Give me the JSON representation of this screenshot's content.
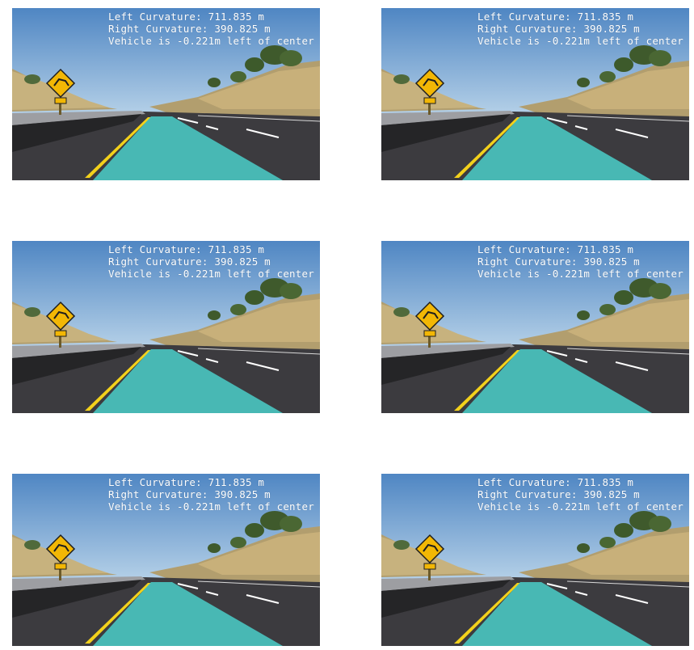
{
  "colors": {
    "sky_top": "#5d8dc4",
    "sky_bottom": "#a9c7e3",
    "lane_fill": "#49c7c1",
    "asphalt": "#3c3b3f",
    "yellow_line": "#f3d11b",
    "hill_dry": "#b29e6e",
    "tree": "#3f5a2c",
    "sign_yellow": "#f2b705"
  },
  "panels": [
    {
      "lines": {
        "left_curvature": "Left Curvature: 711.835 m",
        "right_curvature": "Right Curvature: 390.825 m",
        "vehicle_offset": "Vehicle is -0.221m left of center"
      }
    },
    {
      "lines": {
        "left_curvature": "Left Curvature: 711.835 m",
        "right_curvature": "Right Curvature: 390.825 m",
        "vehicle_offset": "Vehicle is -0.221m left of center"
      }
    },
    {
      "lines": {
        "left_curvature": "Left Curvature: 711.835 m",
        "right_curvature": "Right Curvature: 390.825 m",
        "vehicle_offset": "Vehicle is -0.221m left of center"
      }
    },
    {
      "lines": {
        "left_curvature": "Left Curvature: 711.835 m",
        "right_curvature": "Right Curvature: 390.825 m",
        "vehicle_offset": "Vehicle is -0.221m left of center"
      }
    },
    {
      "lines": {
        "left_curvature": "Left Curvature: 711.835 m",
        "right_curvature": "Right Curvature: 390.825 m",
        "vehicle_offset": "Vehicle is -0.221m left of center"
      }
    },
    {
      "lines": {
        "left_curvature": "Left Curvature: 711.835 m",
        "right_curvature": "Right Curvature: 390.825 m",
        "vehicle_offset": "Vehicle is -0.221m left of center"
      }
    }
  ]
}
